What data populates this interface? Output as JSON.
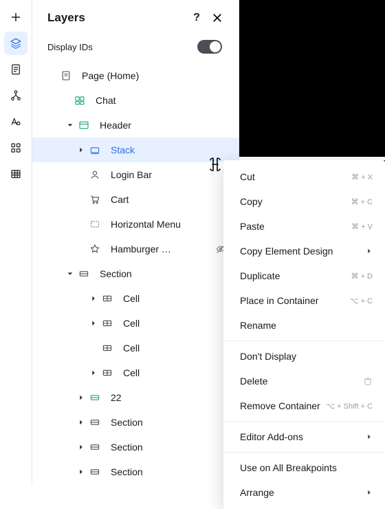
{
  "panel": {
    "title": "Layers",
    "display_ids_label": "Display IDs",
    "display_ids_on": true
  },
  "rail": {
    "items": [
      {
        "name": "add",
        "active": false
      },
      {
        "name": "layers",
        "active": true
      },
      {
        "name": "pages",
        "active": false
      },
      {
        "name": "site-structure",
        "active": false
      },
      {
        "name": "theme",
        "active": false
      },
      {
        "name": "apps",
        "active": false
      },
      {
        "name": "data",
        "active": false
      }
    ]
  },
  "tree": {
    "rows": [
      {
        "label": "Page (Home)",
        "icon": "page",
        "depth": 0,
        "caret": "",
        "iconColor": "gray"
      },
      {
        "label": "Chat",
        "icon": "chat",
        "depth": 1,
        "caret": "",
        "iconColor": "green"
      },
      {
        "label": "Header",
        "icon": "header",
        "depth": 2,
        "caret": "down",
        "iconColor": "green"
      },
      {
        "label": "Stack",
        "icon": "stack",
        "depth": 3,
        "caret": "right",
        "iconColor": "blue",
        "selected": true
      },
      {
        "label": "Login Bar",
        "icon": "login",
        "depth": 3,
        "caret": "",
        "iconColor": "gray"
      },
      {
        "label": "Cart",
        "icon": "cart",
        "depth": 3,
        "caret": "",
        "iconColor": "gray"
      },
      {
        "label": "Horizontal Menu",
        "icon": "hmenu",
        "depth": 3,
        "caret": "",
        "iconColor": "gray"
      },
      {
        "label": "Hamburger …",
        "icon": "star",
        "depth": 3,
        "caret": "",
        "iconColor": "gray",
        "hiddenEye": true
      },
      {
        "label": "Section",
        "icon": "section",
        "depth": 2,
        "caret": "down",
        "iconColor": "gray"
      },
      {
        "label": "Cell",
        "icon": "cell",
        "depth": 5,
        "caret": "right",
        "iconColor": "gray"
      },
      {
        "label": "Cell",
        "icon": "cell",
        "depth": 5,
        "caret": "right",
        "iconColor": "gray"
      },
      {
        "label": "Cell",
        "icon": "cell",
        "depth": 5,
        "caret": "",
        "iconColor": "gray"
      },
      {
        "label": "Cell",
        "icon": "cell",
        "depth": 5,
        "caret": "right",
        "iconColor": "gray"
      },
      {
        "label": "22",
        "icon": "section-g",
        "depth": 4,
        "caret": "right",
        "iconColor": "green"
      },
      {
        "label": "Section",
        "icon": "section",
        "depth": 4,
        "caret": "right",
        "iconColor": "gray"
      },
      {
        "label": "Section",
        "icon": "section",
        "depth": 4,
        "caret": "right",
        "iconColor": "gray"
      },
      {
        "label": "Section",
        "icon": "section",
        "depth": 4,
        "caret": "right",
        "iconColor": "gray"
      }
    ]
  },
  "context_menu": {
    "groups": [
      [
        {
          "label": "Cut",
          "shortcut": "⌘ + X"
        },
        {
          "label": "Copy",
          "shortcut": "⌘ + C"
        },
        {
          "label": "Paste",
          "shortcut": "⌘ + V"
        },
        {
          "label": "Copy Element Design",
          "submenu": true
        },
        {
          "label": "Duplicate",
          "shortcut": "⌘ + D"
        },
        {
          "label": "Place in Container",
          "shortcut": "⌥ + C"
        },
        {
          "label": "Rename"
        }
      ],
      [
        {
          "label": "Don't Display"
        },
        {
          "label": "Delete",
          "trash": true
        },
        {
          "label": "Remove Container",
          "shortcut": "⌥ + Shift + C"
        }
      ],
      [
        {
          "label": "Editor Add-ons",
          "submenu": true
        }
      ],
      [
        {
          "label": "Use on All Breakpoints"
        },
        {
          "label": "Arrange",
          "submenu": true
        }
      ]
    ]
  }
}
